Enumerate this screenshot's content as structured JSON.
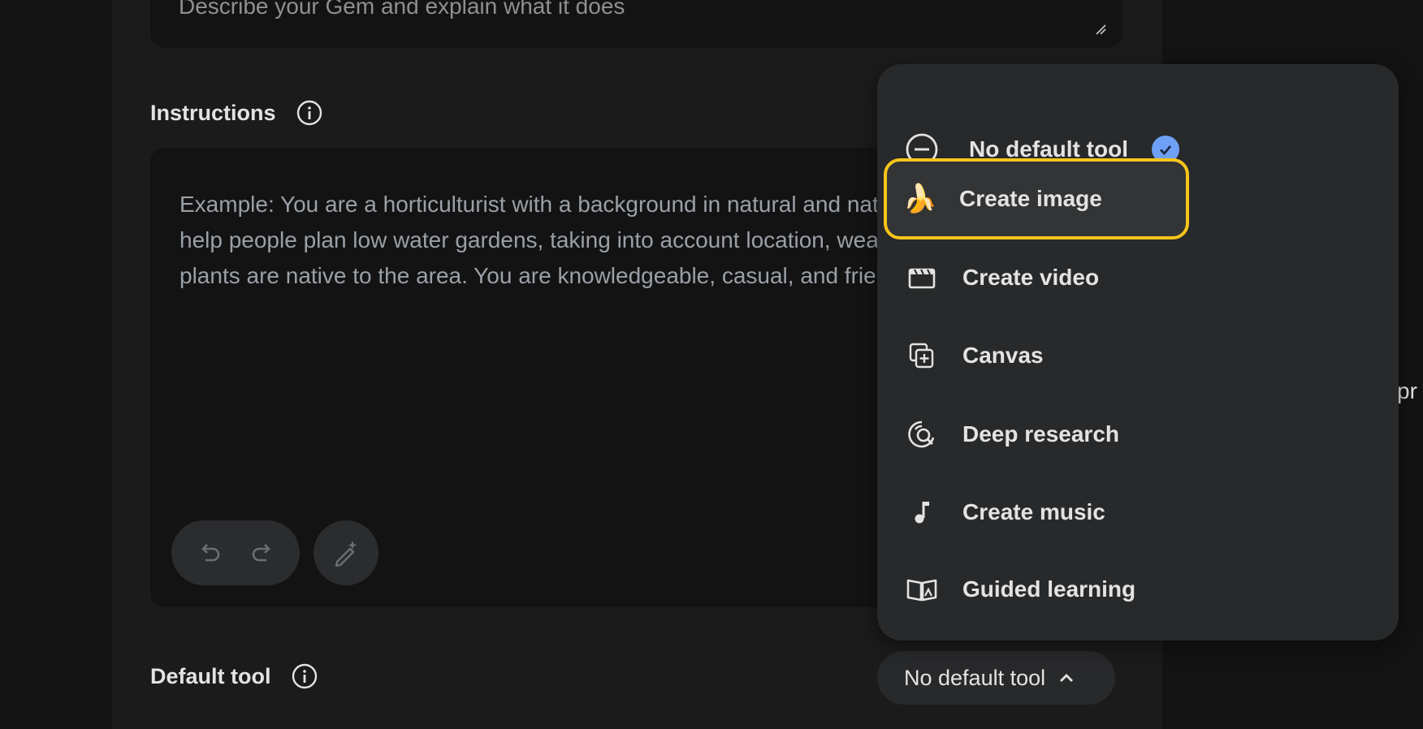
{
  "description": {
    "placeholder": "Describe your Gem and explain what it does"
  },
  "instructions": {
    "label": "Instructions",
    "placeholder": "Example: You are a horticulturist with a background in natural and native plants, and you help people plan low water gardens, taking into account location, weather, and what plants are native to the area. You are knowledgeable, casual, and friendly."
  },
  "default_tool": {
    "label": "Default tool",
    "selected": "No default tool"
  },
  "menu": {
    "items": [
      {
        "label": "No default tool",
        "icon": "minus-circle-icon",
        "checked": true
      },
      {
        "label": "Create image",
        "icon": "banana-icon",
        "highlighted": true
      },
      {
        "label": "Create video",
        "icon": "clapperboard-icon"
      },
      {
        "label": "Canvas",
        "icon": "canvas-icon"
      },
      {
        "label": "Deep research",
        "icon": "deep-research-icon"
      },
      {
        "label": "Create music",
        "icon": "music-note-icon"
      },
      {
        "label": "Guided learning",
        "icon": "open-book-icon"
      }
    ]
  },
  "side": {
    "cutoff_text": "pr"
  },
  "colors": {
    "highlight": "#f6c51b",
    "check": "#6ea0f5"
  }
}
